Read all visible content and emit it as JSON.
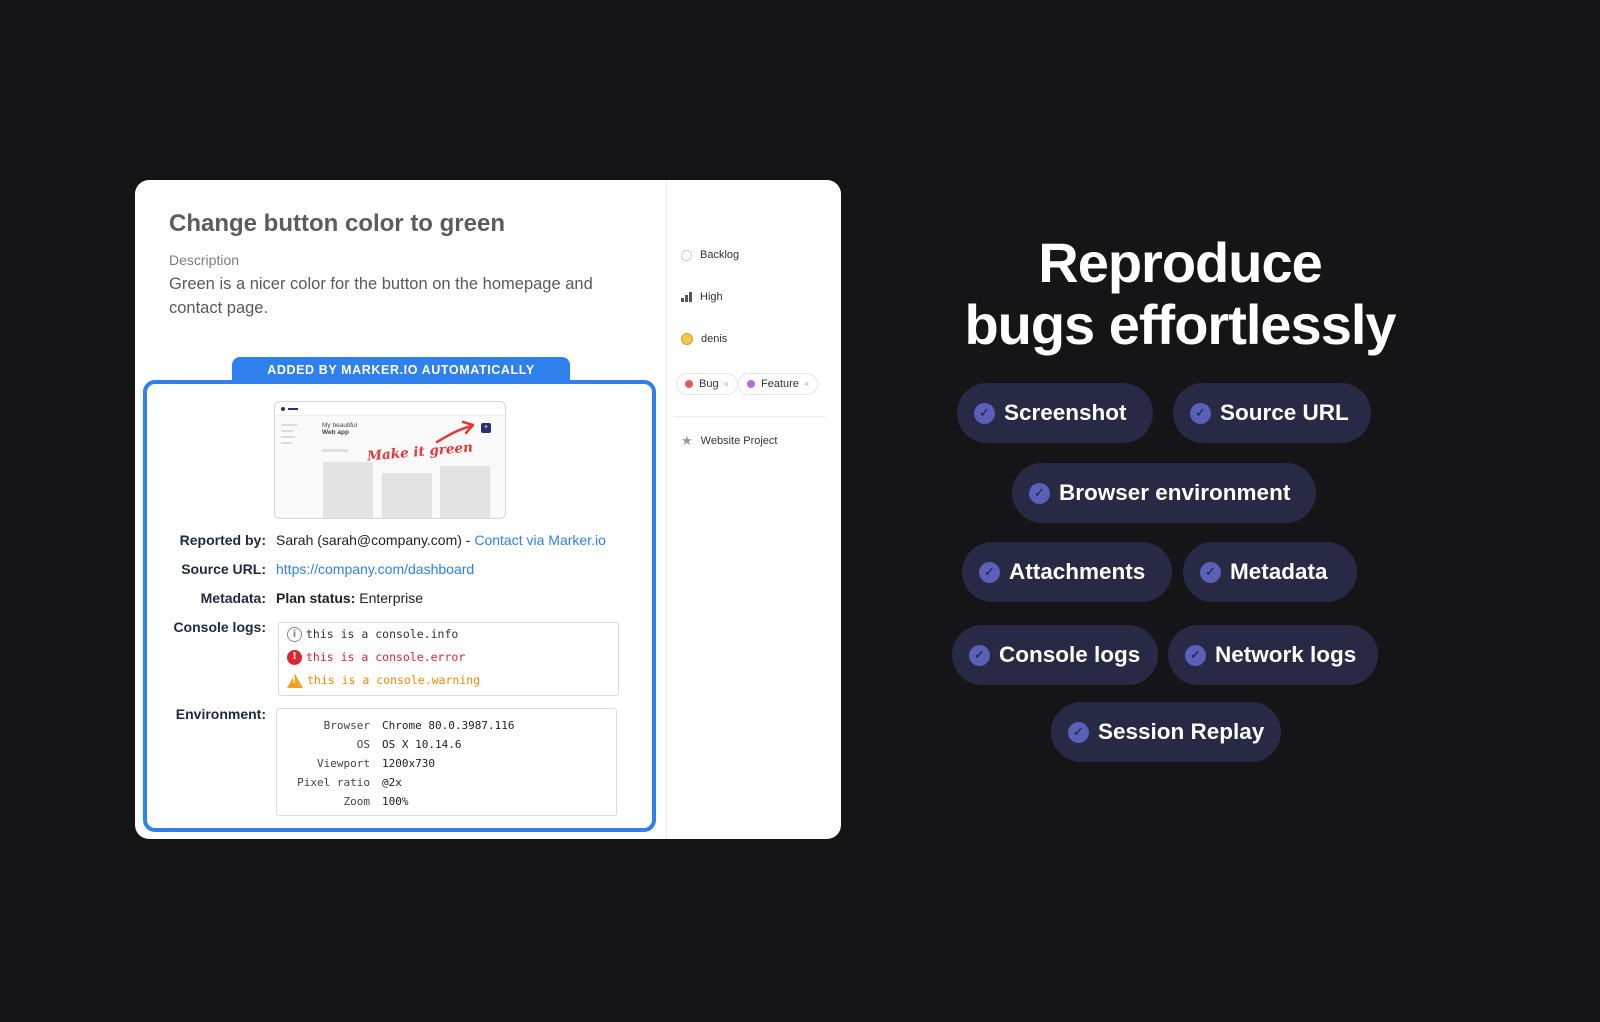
{
  "issue": {
    "title": "Change button color to green",
    "description_label": "Description",
    "description": "Green is a nicer color for the button on the homepage and contact page.",
    "auto_banner": "ADDED BY MARKER.IO AUTOMATICALLY",
    "screenshot": {
      "app_title_line1": "My beautiful",
      "app_title_line2": "Web app",
      "annotation": "Make it green",
      "add_symbol": "+"
    },
    "reported_by_label": "Reported by:",
    "reporter": "Sarah (sarah@company.com) - ",
    "contact_link": "Contact via Marker.io",
    "source_url_label": "Source URL:",
    "source_url": "https://company.com/dashboard",
    "metadata_label": "Metadata:",
    "metadata_key": "Plan status:",
    "metadata_value": " Enterprise",
    "console_label": "Console logs:",
    "console_logs": [
      {
        "level": "info",
        "icon": "i",
        "text": "this is a console.info"
      },
      {
        "level": "error",
        "icon": "!",
        "text": "this is a console.error"
      },
      {
        "level": "warning",
        "icon": "!",
        "text": "this is a console.warning"
      }
    ],
    "environment_label": "Environment:",
    "environment": [
      {
        "key": "Browser",
        "value": "Chrome 80.0.3987.116"
      },
      {
        "key": "OS",
        "value": "OS X 10.14.6"
      },
      {
        "key": "Viewport",
        "value": "1200x730"
      },
      {
        "key": "Pixel ratio",
        "value": "@2x"
      },
      {
        "key": "Zoom",
        "value": "100%"
      }
    ]
  },
  "side": {
    "status": "Backlog",
    "priority": "High",
    "assignee": "denis",
    "tags": [
      {
        "label": "Bug",
        "color": "#eb5757",
        "remove": "×"
      },
      {
        "label": "Feature",
        "color": "#bb6bd9",
        "remove": "×"
      }
    ],
    "project": "Website Project"
  },
  "hero": {
    "line1": "Reproduce",
    "line2": "bugs effortlessly",
    "features": [
      "Screenshot",
      "Source URL",
      "Browser environment",
      "Attachments",
      "Metadata",
      "Console logs",
      "Network logs",
      "Session Replay"
    ],
    "check_glyph": "✓"
  },
  "colors": {
    "background": "#151518",
    "accent_blue": "#2f80ed",
    "pill_bg": "#282945",
    "check_bg": "#5a5fb8",
    "error_red": "#e0262d",
    "warning_orange": "#f0890d"
  }
}
